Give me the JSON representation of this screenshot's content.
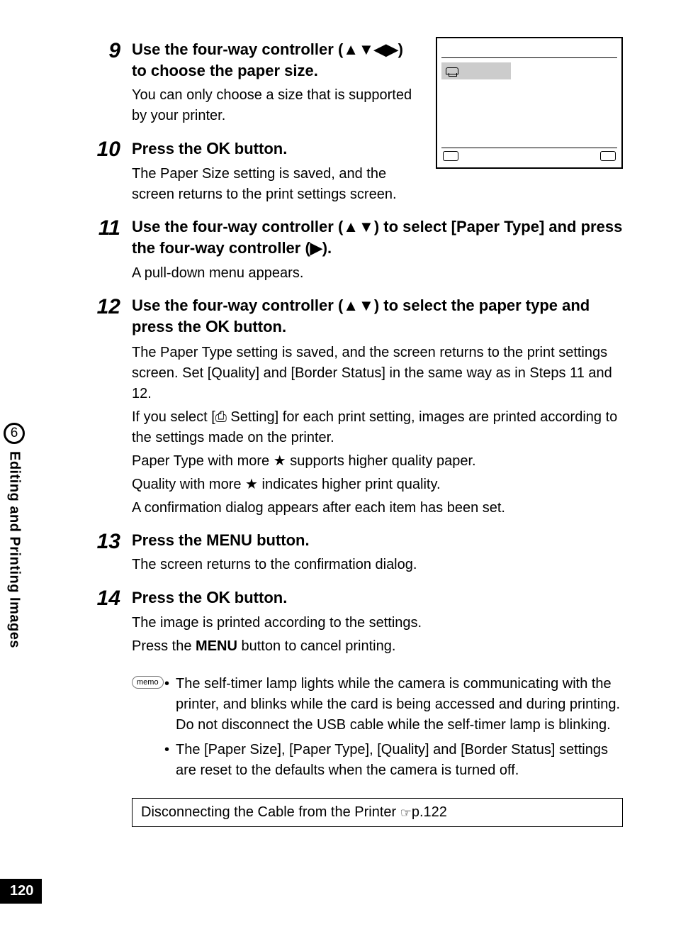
{
  "side": {
    "chapter_num": "6",
    "chapter_label": "Editing and Printing Images"
  },
  "page_number": "120",
  "illustration": {
    "printer_glyph": "⌧"
  },
  "steps": [
    {
      "num": "9",
      "head_parts": [
        "Use the four-way controller (",
        "▲▼◀▶",
        ") to choose the paper size."
      ],
      "desc_lines": [
        "You can only choose a size that is supported by your printer."
      ]
    },
    {
      "num": "10",
      "head_parts": [
        "Press the ",
        "OK",
        " button."
      ],
      "desc_lines": [
        "The Paper Size setting is saved, and the screen returns to the print settings screen."
      ]
    },
    {
      "num": "11",
      "head_parts": [
        "Use the four-way controller (",
        "▲▼",
        ") to select [Paper Type] and press the four-way controller (",
        "▶",
        ")."
      ],
      "desc_lines": [
        "A pull-down menu appears."
      ]
    },
    {
      "num": "12",
      "head_parts": [
        "Use the four-way controller (",
        "▲▼",
        ") to select the paper type and press the ",
        "OK",
        " button."
      ],
      "desc_lines": [
        "The Paper Type setting is saved, and the screen returns to the print settings screen. Set [Quality] and [Border Status] in the same way as in Steps 11 and 12.",
        "If you select [⎙ Setting] for each print setting, images are printed according to the settings made on the printer.",
        "Paper Type with more ★ supports higher quality paper.",
        "Quality with more ★ indicates higher print quality.",
        "A confirmation dialog appears after each item has been set."
      ]
    },
    {
      "num": "13",
      "head_parts": [
        "Press the ",
        "MENU",
        " button."
      ],
      "desc_lines": [
        "The screen returns to the confirmation dialog."
      ]
    },
    {
      "num": "14",
      "head_parts": [
        "Press the ",
        "OK",
        " button."
      ],
      "desc_lines": [
        "The image is printed according to the settings.",
        "Press the MENU button to cancel printing."
      ]
    }
  ],
  "memo": {
    "label": "memo",
    "items": [
      "The self-timer lamp lights while the camera is communicating with the printer, and blinks while the card is being accessed and during printing. Do not disconnect the USB cable while the self-timer lamp is blinking.",
      "The [Paper Size], [Paper Type], [Quality] and [Border Status] settings are reset to the defaults when the camera is turned off."
    ]
  },
  "ref": {
    "text": "Disconnecting the Cable from the Printer ",
    "hand": "☞",
    "page": "p.122"
  }
}
